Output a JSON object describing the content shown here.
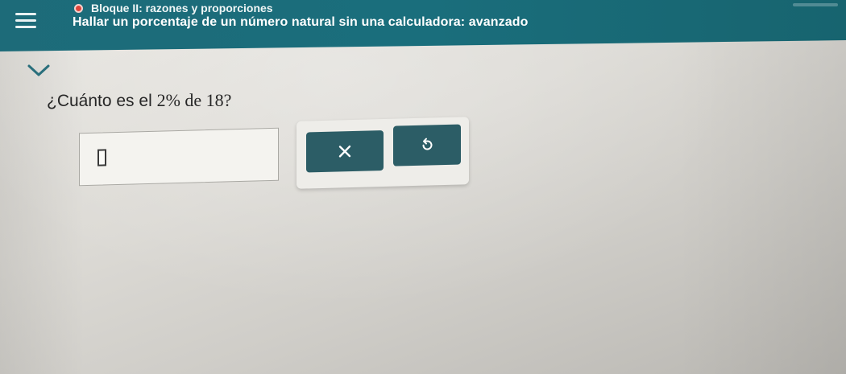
{
  "header": {
    "unit_title": "Bloque II: razones y proporciones",
    "exercise_title": "Hallar un porcentaje de un número natural sin una calculadora: avanzado"
  },
  "question": {
    "prefix": "¿Cuánto es el ",
    "expression": "2% de 18?"
  },
  "answer": {
    "value": ""
  },
  "icons": {
    "menu": "hamburger-menu-icon",
    "status": "red-dot-icon",
    "expand": "chevron-down-icon",
    "clear": "x-icon",
    "undo": "undo-arrow-icon"
  },
  "colors": {
    "header": "#1d6b79",
    "button": "#2c5d66",
    "status_dot": "#e0443a"
  }
}
